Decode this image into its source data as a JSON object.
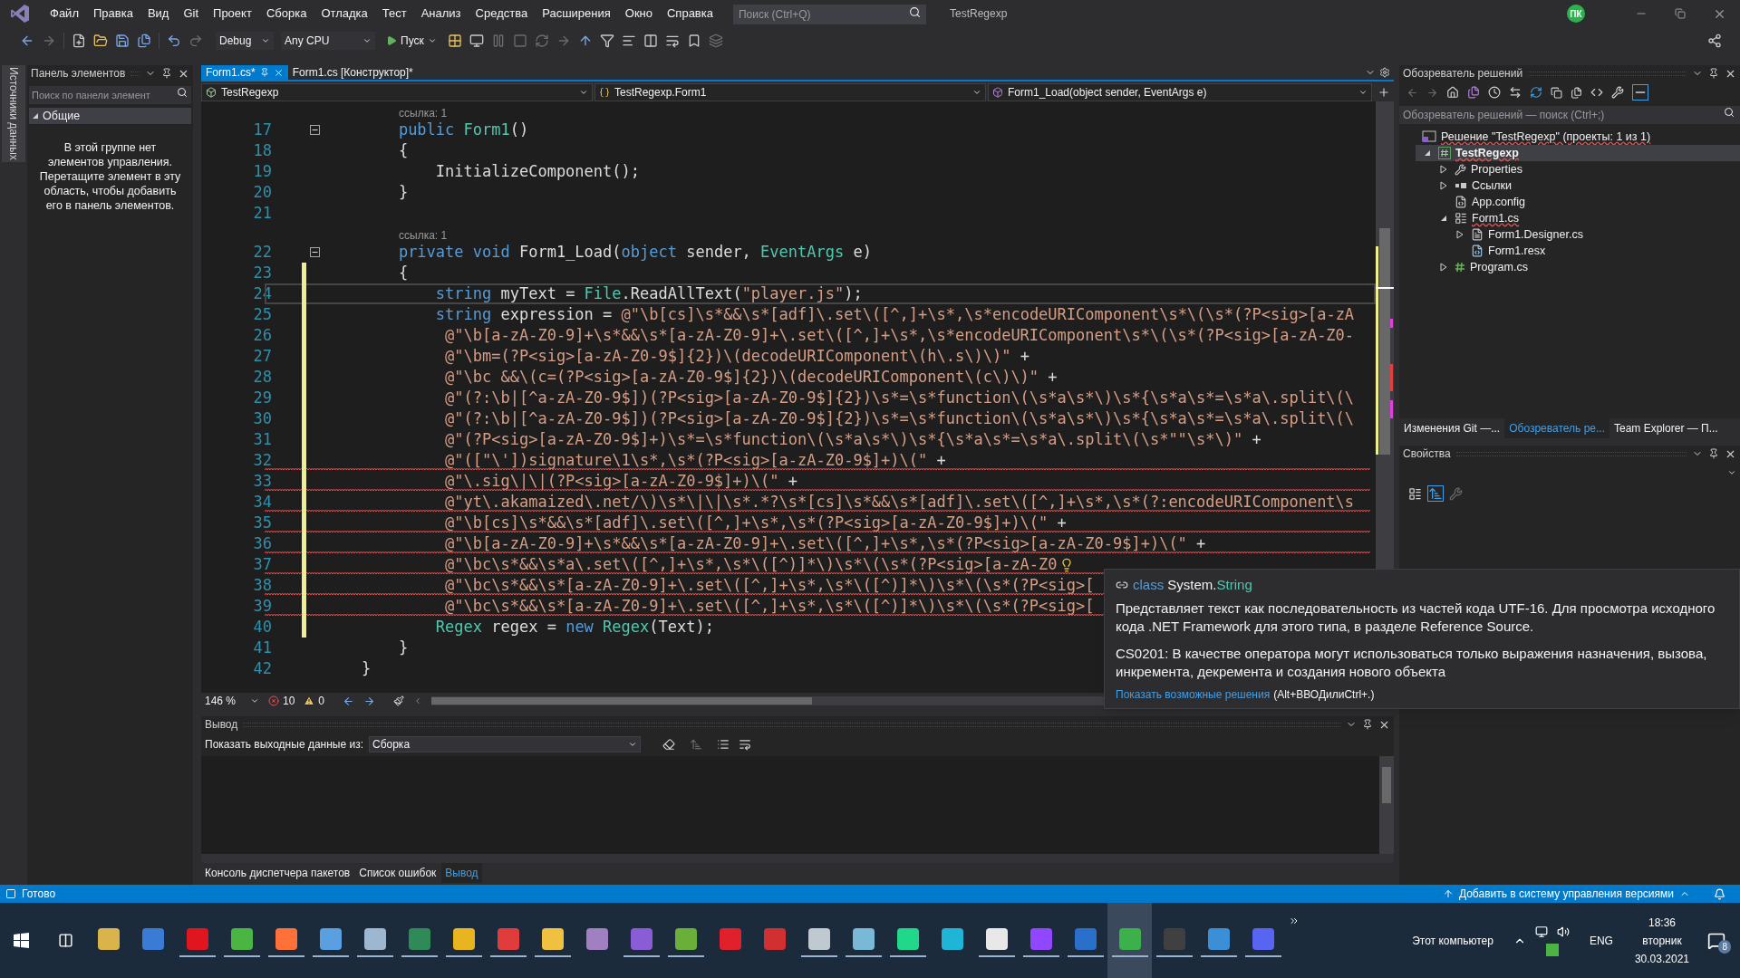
{
  "menu": [
    "Файл",
    "Правка",
    "Вид",
    "Git",
    "Проект",
    "Сборка",
    "Отладка",
    "Тест",
    "Анализ",
    "Средства",
    "Расширения",
    "Окно",
    "Справка"
  ],
  "search": {
    "placeholder": "Поиск (Ctrl+Q)"
  },
  "window": {
    "title": "TestRegexp"
  },
  "user": {
    "initials": "ПК"
  },
  "toolbar": {
    "configuration": "Debug",
    "platform": "Any CPU",
    "run": "Пуск"
  },
  "side_strip": {
    "label": "Источники данных"
  },
  "toolbox": {
    "title": "Панель элементов",
    "search_placeholder": "Поиск по панели элемент",
    "group": {
      "label": "Общие",
      "expanded": true
    },
    "empty_message": "В этой группе нет элементов управления. Перетащите элемент в эту область, чтобы добавить его в панель элементов."
  },
  "editor": {
    "tabs": [
      {
        "label": "Form1.cs*",
        "selected": true
      },
      {
        "label": "Form1.cs [Конструктор]*",
        "selected": false
      }
    ],
    "nav": [
      "TestRegexp",
      "TestRegexp.Form1",
      "Form1_Load(object sender, EventArgs e)"
    ],
    "lines": [
      {
        "kind": "codelens",
        "text": "ссылка: 1"
      },
      {
        "kind": "code",
        "number": "17",
        "foldable": true,
        "modified": false,
        "current": false,
        "error": false,
        "tokens": [
          {
            "kind": "keyword",
            "text": "        public "
          },
          {
            "kind": "type",
            "text": "Form1"
          },
          {
            "kind": "plain",
            "text": "()"
          }
        ]
      },
      {
        "kind": "code",
        "number": "18",
        "foldable": false,
        "modified": false,
        "current": false,
        "error": false,
        "tokens": [
          {
            "kind": "plain",
            "text": "        {"
          }
        ]
      },
      {
        "kind": "code",
        "number": "19",
        "foldable": false,
        "modified": false,
        "current": false,
        "error": false,
        "tokens": [
          {
            "kind": "plain",
            "text": "            InitializeComponent();"
          }
        ]
      },
      {
        "kind": "code",
        "number": "20",
        "foldable": false,
        "modified": false,
        "current": false,
        "error": false,
        "tokens": [
          {
            "kind": "plain",
            "text": "        }"
          }
        ]
      },
      {
        "kind": "code",
        "number": "21",
        "foldable": false,
        "modified": false,
        "current": false,
        "error": false
      },
      {
        "kind": "codelens",
        "text": "ссылка: 1"
      },
      {
        "kind": "code",
        "number": "22",
        "foldable": true,
        "modified": false,
        "current": false,
        "error": false,
        "tokens": [
          {
            "kind": "keyword",
            "text": "        private void "
          },
          {
            "kind": "plain",
            "text": "Form1_Load("
          },
          {
            "kind": "keyword",
            "text": "object "
          },
          {
            "kind": "plain",
            "text": "sender, "
          },
          {
            "kind": "type",
            "text": "EventArgs "
          },
          {
            "kind": "plain",
            "text": "e)"
          }
        ]
      },
      {
        "kind": "code",
        "number": "23",
        "foldable": false,
        "modified": true,
        "current": false,
        "error": false,
        "tokens": [
          {
            "kind": "plain",
            "text": "        {"
          }
        ]
      },
      {
        "kind": "code",
        "number": "24",
        "foldable": false,
        "modified": true,
        "current": true,
        "error": false,
        "tokens": [
          {
            "kind": "keyword",
            "text": "            string "
          },
          {
            "kind": "plain",
            "text": "myText = "
          },
          {
            "kind": "type",
            "text": "File"
          },
          {
            "kind": "plain",
            "text": ".ReadAllText("
          },
          {
            "kind": "string",
            "text": "\"player.js\""
          },
          {
            "kind": "plain",
            "text": ");"
          }
        ]
      },
      {
        "kind": "code",
        "number": "25",
        "foldable": false,
        "modified": true,
        "current": false,
        "error": false,
        "tokens": [
          {
            "kind": "keyword",
            "text": "            string "
          },
          {
            "kind": "plain",
            "text": "expression = "
          },
          {
            "kind": "string",
            "text": "@\"\\b[cs]\\s*&&\\s*[adf]\\.set\\([^,]+\\s*,\\s*encodeURIComponent\\s*\\(\\s*(?P<sig>[a-zA"
          }
        ]
      },
      {
        "kind": "code",
        "number": "26",
        "foldable": false,
        "modified": true,
        "current": false,
        "error": false,
        "tokens": [
          {
            "kind": "string",
            "text": "             @\"\\b[a-zA-Z0-9]+\\s*&&\\s*[a-zA-Z0-9]+\\.set\\([^,]+\\s*,\\s*encodeURIComponent\\s*\\(\\s*(?P<sig>[a-zA-Z0-"
          }
        ]
      },
      {
        "kind": "code",
        "number": "27",
        "foldable": false,
        "modified": true,
        "current": false,
        "error": false,
        "tokens": [
          {
            "kind": "string",
            "text": "             @\"\\bm=(?P<sig>[a-zA-Z0-9$]{2})\\(decodeURIComponent\\(h\\.s\\)\\)\""
          },
          {
            "kind": "plain",
            "text": " +"
          }
        ]
      },
      {
        "kind": "code",
        "number": "28",
        "foldable": false,
        "modified": true,
        "current": false,
        "error": false,
        "tokens": [
          {
            "kind": "string",
            "text": "             @\"\\bc &&\\(c=(?P<sig>[a-zA-Z0-9$]{2})\\(decodeURIComponent\\(c\\)\\)\""
          },
          {
            "kind": "plain",
            "text": " +"
          }
        ]
      },
      {
        "kind": "code",
        "number": "29",
        "foldable": false,
        "modified": true,
        "current": false,
        "error": false,
        "tokens": [
          {
            "kind": "string",
            "text": "             @\"(?:\\b|[^a-zA-Z0-9$])(?P<sig>[a-zA-Z0-9$]{2})\\s*=\\s*function\\(\\s*a\\s*\\)\\s*{\\s*a\\s*=\\s*a\\.split\\(\\"
          }
        ]
      },
      {
        "kind": "code",
        "number": "30",
        "foldable": false,
        "modified": true,
        "current": false,
        "error": false,
        "tokens": [
          {
            "kind": "string",
            "text": "             @\"(?:\\b|[^a-zA-Z0-9$])(?P<sig>[a-zA-Z0-9$]{2})\\s*=\\s*function\\(\\s*a\\s*\\)\\s*{\\s*a\\s*=\\s*a\\.split\\(\\"
          }
        ]
      },
      {
        "kind": "code",
        "number": "31",
        "foldable": false,
        "modified": true,
        "current": false,
        "error": false,
        "tokens": [
          {
            "kind": "string",
            "text": "             @\"(?P<sig>[a-zA-Z0-9$]+)\\s*=\\s*function\\(\\s*a\\s*\\)\\s*{\\s*a\\s*=\\s*a\\.split\\(\\s*\"\"\\s*\\)\""
          },
          {
            "kind": "plain",
            "text": " +"
          }
        ]
      },
      {
        "kind": "code",
        "number": "32",
        "foldable": false,
        "modified": true,
        "current": false,
        "error": true,
        "tokens": [
          {
            "kind": "string",
            "text": "             @\"([\"\\'])signature\\1\\s*,\\s*(?P<sig>[a-zA-Z0-9$]+)\\(\""
          },
          {
            "kind": "plain",
            "text": " +"
          }
        ]
      },
      {
        "kind": "code",
        "number": "33",
        "foldable": false,
        "modified": true,
        "current": false,
        "error": true,
        "tokens": [
          {
            "kind": "string",
            "text": "             @\"\\.sig\\|\\|(?P<sig>[a-zA-Z0-9$]+)\\(\""
          },
          {
            "kind": "plain",
            "text": " +"
          }
        ]
      },
      {
        "kind": "code",
        "number": "34",
        "foldable": false,
        "modified": true,
        "current": false,
        "error": true,
        "tokens": [
          {
            "kind": "string",
            "text": "             @\"yt\\.akamaized\\.net/\\)\\s*\\|\\|\\s*.*?\\s*[cs]\\s*&&\\s*[adf]\\.set\\([^,]+\\s*,\\s*(?:encodeURIComponent\\s"
          }
        ]
      },
      {
        "kind": "code",
        "number": "35",
        "foldable": false,
        "modified": true,
        "current": false,
        "error": true,
        "tokens": [
          {
            "kind": "string",
            "text": "             @\"\\b[cs]\\s*&&\\s*[adf]\\.set\\([^,]+\\s*,\\s*(?P<sig>[a-zA-Z0-9$]+)\\(\""
          },
          {
            "kind": "plain",
            "text": " +"
          }
        ]
      },
      {
        "kind": "code",
        "number": "36",
        "foldable": false,
        "modified": true,
        "current": false,
        "error": true,
        "tokens": [
          {
            "kind": "string",
            "text": "             @\"\\b[a-zA-Z0-9]+\\s*&&\\s*[a-zA-Z0-9]+\\.set\\([^,]+\\s*,\\s*(?P<sig>[a-zA-Z0-9$]+)\\(\""
          },
          {
            "kind": "plain",
            "text": " +"
          }
        ]
      },
      {
        "kind": "code",
        "number": "37",
        "foldable": false,
        "modified": true,
        "current": false,
        "error": true,
        "lightbulb": true,
        "tokens": [
          {
            "kind": "string",
            "text": "             @\"\\bc\\s*&&\\s*a\\.set\\([^,]+\\s*,\\s*\\([^)]*\\)\\s*\\(\\s*(?P<sig>[a-zA-Z0"
          }
        ]
      },
      {
        "kind": "code",
        "number": "38",
        "foldable": false,
        "modified": true,
        "current": false,
        "error": true,
        "tokens": [
          {
            "kind": "string",
            "text": "             @\"\\bc\\s*&&\\s*[a-zA-Z0-9]+\\.set\\([^,]+\\s*,\\s*\\([^)]*\\)\\s*\\(\\s*(?P<sig>["
          }
        ]
      },
      {
        "kind": "code",
        "number": "39",
        "foldable": false,
        "modified": true,
        "current": false,
        "error": true,
        "tokens": [
          {
            "kind": "string",
            "text": "             @\"\\bc\\s*&&\\s*[a-zA-Z0-9]+\\.set\\([^,]+\\s*,\\s*\\([^)]*\\)\\s*\\(\\s*(?P<sig>["
          }
        ]
      },
      {
        "kind": "code",
        "number": "40",
        "foldable": false,
        "modified": true,
        "current": false,
        "error": false,
        "tokens": [
          {
            "kind": "type",
            "text": "            Regex "
          },
          {
            "kind": "plain",
            "text": "regex = "
          },
          {
            "kind": "keyword",
            "text": "new "
          },
          {
            "kind": "type",
            "text": "Regex"
          },
          {
            "kind": "plain",
            "text": "(Text);"
          }
        ]
      },
      {
        "kind": "code",
        "number": "41",
        "foldable": false,
        "modified": false,
        "current": false,
        "error": false,
        "tokens": [
          {
            "kind": "plain",
            "text": "        }"
          }
        ]
      },
      {
        "kind": "code",
        "number": "42",
        "foldable": false,
        "modified": false,
        "current": false,
        "error": false,
        "tokens": [
          {
            "kind": "plain",
            "text": "    }"
          }
        ]
      }
    ],
    "zoom": "146 %",
    "errors": "10",
    "warnings": "0"
  },
  "tooltip": {
    "keyword": "class",
    "namespace": "System.",
    "type": "String",
    "description": "Представляет текст как последовательность из частей кода UTF-16. Для просмотра исходного кода .NET Framework для этого типа, в разделе Reference Source.",
    "error": "CS0201: В качестве оператора могут использоваться только выражения назначения, вызова, инкремента, декремента и создания нового объекта",
    "link": "Показать возможные решения",
    "shortcut": "(Alt+ВВОДилиCtrl+.)"
  },
  "solution_explorer": {
    "title": "Обозреватель решений",
    "search_placeholder": "Обозреватель решений — поиск (Ctrl+;)",
    "tree": [
      {
        "label": "Решение \"TestRegexp\" (проекты: 1 из 1)",
        "kind": "solution",
        "error": true,
        "selected": false,
        "children": [
          {
            "label": "TestRegexp",
            "kind": "project",
            "expanded": true,
            "error": true,
            "selected": true,
            "children": [
              {
                "label": "Properties",
                "kind": "properties",
                "expanded": false,
                "error": false,
                "selected": false
              },
              {
                "label": "Ссылки",
                "kind": "references",
                "expanded": false,
                "error": false,
                "selected": false
              },
              {
                "label": "App.config",
                "kind": "config",
                "error": false,
                "selected": false
              },
              {
                "label": "Form1.cs",
                "kind": "form",
                "expanded": true,
                "error": true,
                "selected": false,
                "children": [
                  {
                    "label": "Form1.Designer.cs",
                    "kind": "designer",
                    "expanded": false,
                    "error": false,
                    "selected": false
                  },
                  {
                    "label": "Form1.resx",
                    "kind": "resource",
                    "error": false,
                    "selected": false
                  }
                ]
              },
              {
                "label": "Program.cs",
                "kind": "csharp",
                "expanded": false,
                "error": false,
                "selected": false
              }
            ]
          }
        ]
      }
    ]
  },
  "panel_tabs": [
    {
      "label": "Изменения Git —...",
      "selected": false
    },
    {
      "label": "Обозреватель ре...",
      "selected": true
    },
    {
      "label": "Team Explorer — П...",
      "selected": false
    }
  ],
  "properties": {
    "title": "Свойства"
  },
  "output": {
    "title": "Вывод",
    "source_label": "Показать выходные данные из:",
    "source": "Сборка",
    "tabs": [
      {
        "label": "Консоль диспетчера пакетов",
        "selected": false
      },
      {
        "label": "Список ошибок",
        "selected": false
      },
      {
        "label": "Вывод",
        "selected": true
      }
    ]
  },
  "status_bar": {
    "message": "Готово",
    "source_control": "Добавить в систему управления версиями"
  },
  "taskbar": {
    "apps": [
      {
        "color": "#d9b44a",
        "active": false,
        "running": false
      },
      {
        "color": "#3a7bd5",
        "active": false,
        "running": false
      },
      {
        "color": "#e0151e",
        "active": false,
        "running": true
      },
      {
        "color": "#4bb543",
        "active": false,
        "running": true
      },
      {
        "color": "#ff7139",
        "active": false,
        "running": true
      },
      {
        "color": "#5aa0e0",
        "active": false,
        "running": true
      },
      {
        "color": "#9db7d0",
        "active": false,
        "running": true
      },
      {
        "color": "#2e8b57",
        "active": false,
        "running": true
      },
      {
        "color": "#e8b520",
        "active": false,
        "running": true
      },
      {
        "color": "#e03c3c",
        "active": false,
        "running": true
      },
      {
        "color": "#f0c040",
        "active": false,
        "running": true
      },
      {
        "color": "#a080c0",
        "active": false,
        "running": false
      },
      {
        "color": "#8a5cd6",
        "active": false,
        "running": true
      },
      {
        "color": "#6aaf3a",
        "active": false,
        "running": true
      },
      {
        "color": "#e0202a",
        "active": false,
        "running": false
      },
      {
        "color": "#d03030",
        "active": false,
        "running": false
      },
      {
        "color": "#c0c8d0",
        "active": false,
        "running": true
      },
      {
        "color": "#7ab8d8",
        "active": false,
        "running": true
      },
      {
        "color": "#21d789",
        "active": false,
        "running": true
      },
      {
        "color": "#1fb5d6",
        "active": false,
        "running": false
      },
      {
        "color": "#e8e8e8",
        "active": false,
        "running": true
      },
      {
        "color": "#9146ff",
        "active": false,
        "running": true
      },
      {
        "color": "#2a6fc9",
        "active": false,
        "running": true
      },
      {
        "color": "#3cb04a",
        "active": true,
        "running": true
      },
      {
        "color": "#404040",
        "active": false,
        "running": true
      },
      {
        "color": "#3a8fd6",
        "active": false,
        "running": true
      },
      {
        "color": "#5865f2",
        "active": false,
        "running": true
      }
    ]
  },
  "tray": {
    "label": "Этот компьютер",
    "language": "ENG",
    "time": "18:36",
    "day": "вторник",
    "date": "30.03.2021",
    "notifications": "8"
  }
}
